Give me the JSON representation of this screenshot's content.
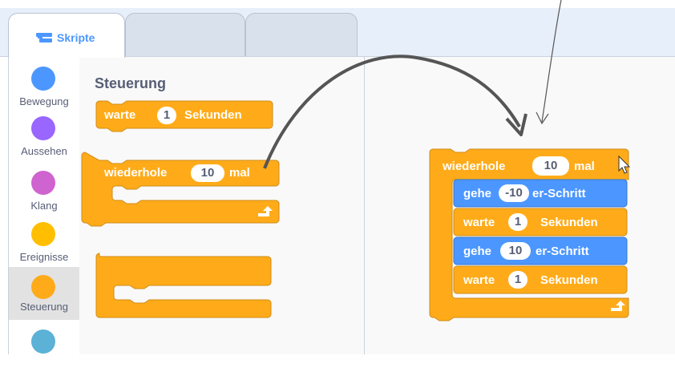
{
  "tabs": [
    {
      "label": "Skripte",
      "icon": "code-blocks-icon",
      "active": true
    },
    {
      "label": "",
      "active": false
    },
    {
      "label": "",
      "active": false
    }
  ],
  "categories": [
    {
      "label": "Bewegung",
      "color": "#4c97ff"
    },
    {
      "label": "Aussehen",
      "color": "#9966ff"
    },
    {
      "label": "Klang",
      "color": "#cf63cf"
    },
    {
      "label": "Ereignisse",
      "color": "#ffbf00"
    },
    {
      "label": "Steuerung",
      "color": "#ffab19",
      "selected": true
    },
    {
      "label": "",
      "color": "#5cb1d6"
    }
  ],
  "palette": {
    "title": "Steuerung",
    "wait": {
      "pre": "warte",
      "value": "1",
      "post": "Sekunden"
    },
    "repeat": {
      "pre": "wiederhole",
      "value": "10",
      "post": "mal"
    }
  },
  "script": {
    "repeat": {
      "pre": "wiederhole",
      "value": "10",
      "post": "mal"
    },
    "blocks": [
      {
        "pre": "gehe",
        "value": "-10",
        "post": "er-Schritt",
        "kind": "motion"
      },
      {
        "pre": "warte",
        "value": "1",
        "post": "Sekunden",
        "kind": "control"
      },
      {
        "pre": "gehe",
        "value": "10",
        "post": "er-Schritt",
        "kind": "motion"
      },
      {
        "pre": "warte",
        "value": "1",
        "post": "Sekunden",
        "kind": "control"
      }
    ]
  },
  "colors": {
    "control": "#ffab19",
    "control_dark": "#cf8b17",
    "motion": "#4c97ff",
    "motion_dark": "#3373cc"
  }
}
